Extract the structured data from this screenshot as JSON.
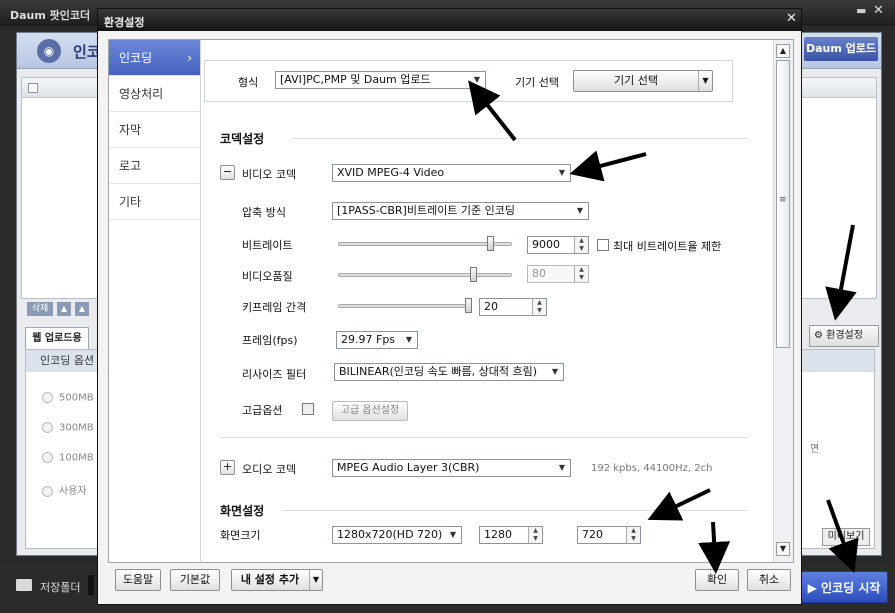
{
  "app": {
    "title": "Daum 팟인코더",
    "encoding_label": "인코딩",
    "daum_upload_button": "Daum 업로드",
    "delete_button": "삭제",
    "web_upload_tab": "웹 업로드용",
    "env_settings_button": "환경설정",
    "encoding_options_header": "인코딩 옵션",
    "radio_options": [
      "500MB",
      "300MB",
      "100MB",
      "사용자"
    ],
    "right_note": "면",
    "mini_button": "미리보기",
    "storage_folder_label": "저장폴더",
    "start_encoding_button": "인코딩 시작"
  },
  "dialog": {
    "title": "환경설정",
    "sidebar": [
      {
        "label": "인코딩",
        "active": true
      },
      {
        "label": "영상처리",
        "active": false
      },
      {
        "label": "자막",
        "active": false
      },
      {
        "label": "로고",
        "active": false
      },
      {
        "label": "기타",
        "active": false
      }
    ],
    "format": {
      "label": "형식",
      "value": "[AVI]PC,PMP 및 Daum 업로드",
      "device_label": "기기 선택",
      "device_value": "기기 선택"
    },
    "codec_section": "코덱설정",
    "video": {
      "toggle": "−",
      "label": "비디오 코덱",
      "codec_value": "XVID MPEG-4 Video",
      "compression_label": "압축 방식",
      "compression_value": "[1PASS-CBR]비트레이트 기준 인코딩",
      "bitrate_label": "비트레이트",
      "bitrate_value": "9000",
      "bitrate_slider_fraction": 0.88,
      "max_bitrate_label": "최대 비트레이트율 제한",
      "quality_label": "비디오품질",
      "quality_value": "80",
      "quality_slider_fraction": 0.78,
      "keyframe_label": "키프레임 간격",
      "keyframe_value": "20",
      "keyframe_slider_fraction": 0.98,
      "fps_label": "프레임(fps)",
      "fps_value": "29.97 Fps",
      "resize_label": "리사이즈 필터",
      "resize_value": "BILINEAR(인코딩 속도 빠름, 상대적 흐림)",
      "advanced_label": "고급옵션",
      "advanced_button": "고급 옵션설정"
    },
    "audio": {
      "toggle": "+",
      "label": "오디오 코덱",
      "codec_value": "MPEG Audio Layer 3(CBR)",
      "info": "192 kpbs, 44100Hz, 2ch"
    },
    "screen_section": "화면설정",
    "screen": {
      "size_label": "화면크기",
      "size_value": "1280x720(HD 720)",
      "width_value": "1280",
      "height_value": "720"
    },
    "footer": {
      "help": "도움말",
      "default": "기본값",
      "add_setting": "내 설정 추가",
      "ok": "확인",
      "cancel": "취소"
    }
  }
}
